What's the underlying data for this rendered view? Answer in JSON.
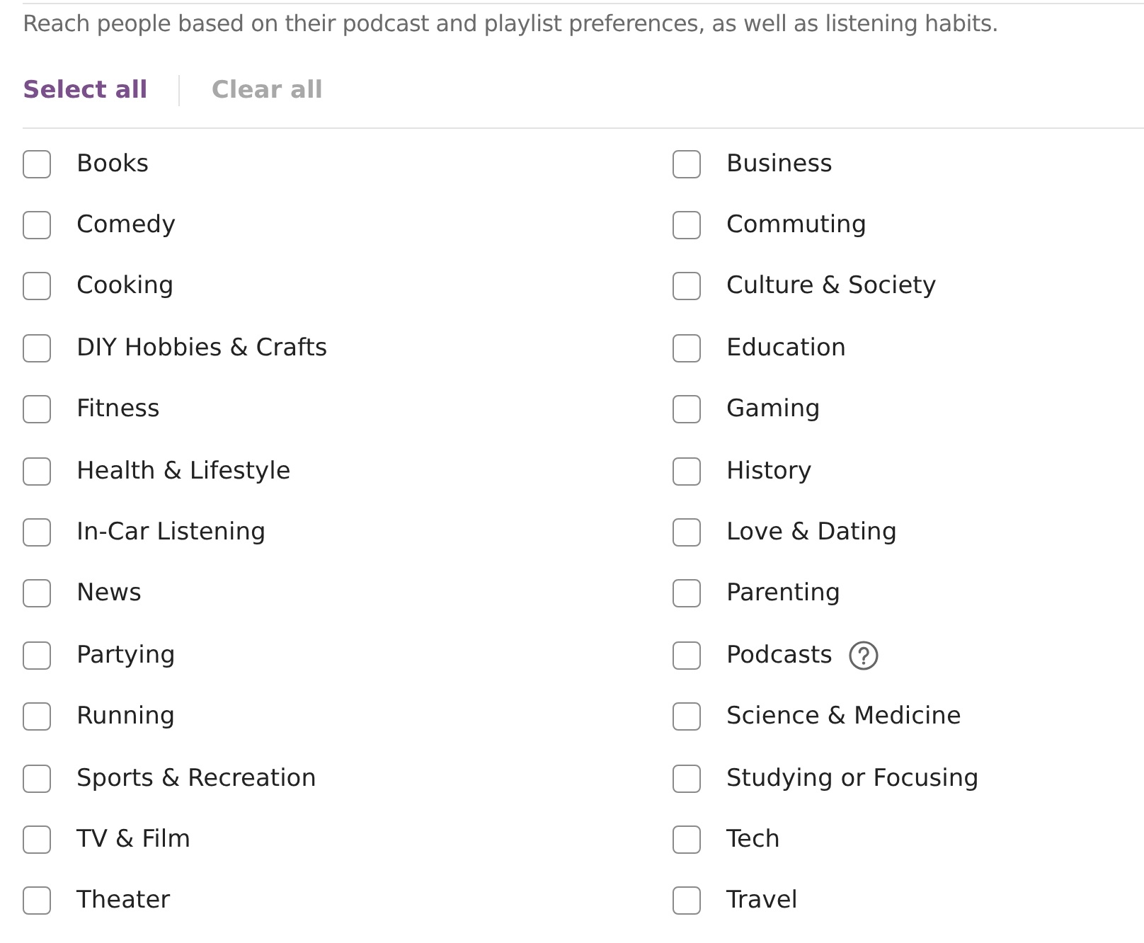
{
  "description": "Reach people based on their podcast and playlist preferences, as well as listening habits.",
  "actions": [
    {
      "label": "Select all",
      "disabled": false
    },
    {
      "label": "Clear all",
      "disabled": true
    }
  ],
  "categories": [
    {
      "label": "Books",
      "checked": false,
      "kind": "plain"
    },
    {
      "label": "Business",
      "checked": false,
      "kind": "plain"
    },
    {
      "label": "Comedy",
      "checked": false,
      "kind": "plain"
    },
    {
      "label": "Commuting",
      "checked": false,
      "kind": "plain"
    },
    {
      "label": "Cooking",
      "checked": false,
      "kind": "plain"
    },
    {
      "label": "Culture & Society",
      "checked": false,
      "kind": "plain"
    },
    {
      "label": "DIY Hobbies & Crafts",
      "checked": false,
      "kind": "plain"
    },
    {
      "label": "Education",
      "checked": false,
      "kind": "plain"
    },
    {
      "label": "Fitness",
      "checked": false,
      "kind": "plain"
    },
    {
      "label": "Gaming",
      "checked": false,
      "kind": "plain"
    },
    {
      "label": "Health & Lifestyle",
      "checked": false,
      "kind": "plain"
    },
    {
      "label": "History",
      "checked": false,
      "kind": "plain"
    },
    {
      "label": "In-Car Listening",
      "checked": false,
      "kind": "plain"
    },
    {
      "label": "Love & Dating",
      "checked": false,
      "kind": "plain"
    },
    {
      "label": "News",
      "checked": false,
      "kind": "plain"
    },
    {
      "label": "Parenting",
      "checked": false,
      "kind": "plain"
    },
    {
      "label": "Partying",
      "checked": false,
      "kind": "plain"
    },
    {
      "label": "Podcasts",
      "checked": false,
      "kind": "help"
    },
    {
      "label": "Running",
      "checked": false,
      "kind": "plain"
    },
    {
      "label": "Science & Medicine",
      "checked": false,
      "kind": "plain"
    },
    {
      "label": "Sports & Recreation",
      "checked": false,
      "kind": "plain"
    },
    {
      "label": "Studying or Focusing",
      "checked": false,
      "kind": "plain"
    },
    {
      "label": "TV & Film",
      "checked": false,
      "kind": "plain"
    },
    {
      "label": "Tech",
      "checked": false,
      "kind": "plain"
    },
    {
      "label": "Theater",
      "checked": false,
      "kind": "plain"
    },
    {
      "label": "Travel",
      "checked": false,
      "kind": "plain"
    }
  ]
}
